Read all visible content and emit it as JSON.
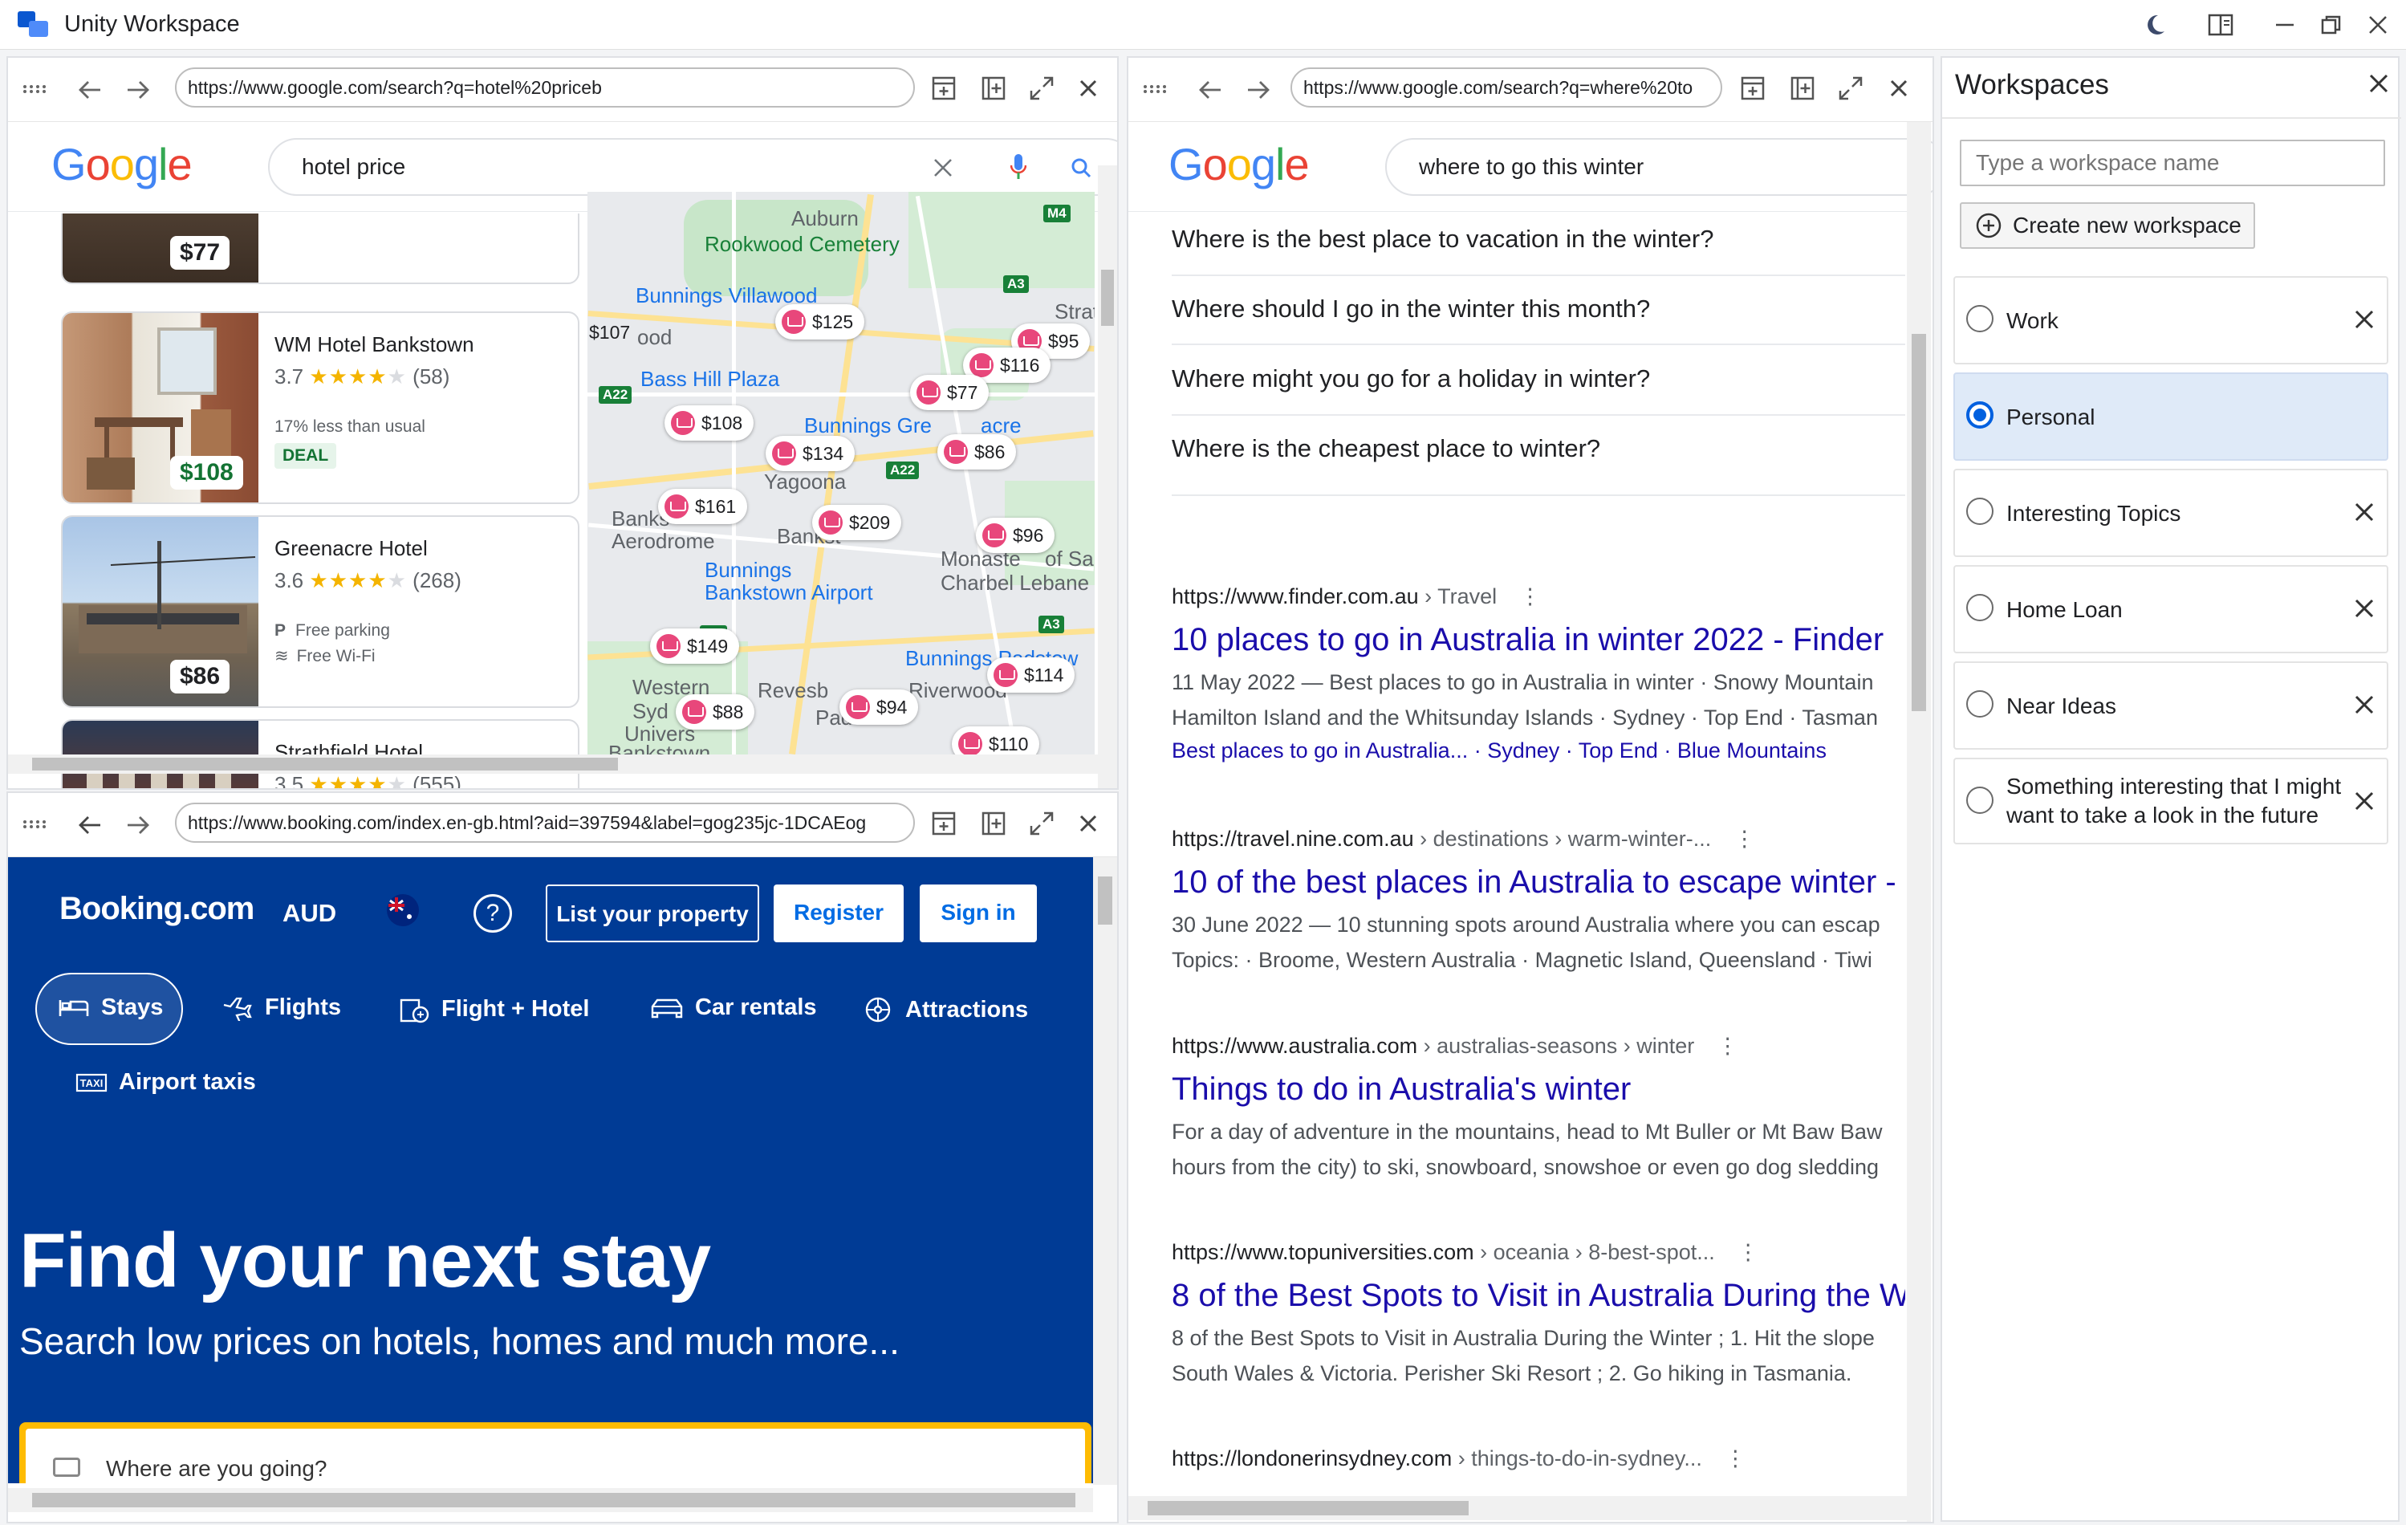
{
  "app": {
    "title": "Unity Workspace"
  },
  "pane_hotels": {
    "url": "https://www.google.com/search?q=hotel%20priceb",
    "search_query": "hotel price",
    "hotels": [
      {
        "name": "",
        "rating": "",
        "reviews": "",
        "price": "$77"
      },
      {
        "name": "WM Hotel Bankstown",
        "rating": "3.7",
        "reviews": "(58)",
        "note1": "17% less than usual",
        "badge": "DEAL",
        "price": "$108"
      },
      {
        "name": "Greenacre Hotel",
        "rating": "3.6",
        "reviews": "(268)",
        "note1": "Free parking",
        "note2": "Free Wi-Fi",
        "price": "$86"
      },
      {
        "name": "Strathfield Hotel",
        "rating": "3.5",
        "reviews": "(555)",
        "price": ""
      }
    ],
    "map": {
      "labels": [
        "Auburn",
        "Rookwood Cemetery",
        "Bunnings Villawood",
        "Strathfi",
        "ood",
        "Bass Hill Plaza",
        "Bunnings Gre",
        "acre",
        "Yagoona",
        "Banks",
        "Aerodrome",
        "Bankst",
        "Monaste",
        "of Sa",
        "Charbel Lebane",
        "Bunnings",
        "Bankstown Airport",
        "Bunnings Padstow",
        "Western",
        "Syd",
        "Univers",
        "Revesb",
        "Riverwood",
        "Pad",
        "Bankstown"
      ],
      "shields": [
        "M4",
        "A3",
        "A22",
        "A22",
        "A3",
        "M4"
      ],
      "pins": [
        "$125",
        "$95",
        "$107",
        "$116",
        "$77",
        "$108",
        "$134",
        "$86",
        "$161",
        "$209",
        "$96",
        "$149",
        "$114",
        "$88",
        "$94",
        "$110"
      ]
    }
  },
  "pane_booking": {
    "url": "https://www.booking.com/index.en-gb.html?aid=397594&label=gog235jc-1DCAEog",
    "logo": "Booking.com",
    "currency": "AUD",
    "help": "?",
    "list_property": "List your property",
    "register": "Register",
    "sign_in": "Sign in",
    "nav": [
      "Stays",
      "Flights",
      "Flight + Hotel",
      "Car rentals",
      "Attractions",
      "Airport taxis"
    ],
    "hero_title": "Find your next stay",
    "hero_sub": "Search low prices on hotels, homes and much more...",
    "search_placeholder": "Where are you going?"
  },
  "pane_winter": {
    "url": "https://www.google.com/search?q=where%20to",
    "search_query": "where to go this winter",
    "suggestions": [
      "Where is the best place to vacation in the winter?",
      "Where should I go in the winter this month?",
      "Where might you go for a holiday in winter?",
      "Where is the cheapest place to winter?"
    ],
    "results": [
      {
        "site": "https://www.finder.com.au",
        "path": " › Travel",
        "title": "10 places to go in Australia in winter 2022 - Finder",
        "snip1": "11 May 2022 — Best places to go in Australia in winter · Snowy Mountain",
        "snip2": "Hamilton Island and the Whitsunday Islands · Sydney · Top End · Tasman",
        "links": "Best places to go in Australia... · Sydney · Top End · Blue Mountains"
      },
      {
        "site": "https://travel.nine.com.au",
        "path": " › destinations › warm-winter-...",
        "title": "10 of the best places in Australia to escape winter -",
        "snip1": "30 June 2022 — 10 stunning spots around Australia where you can escap",
        "snip2": "Topics: · Broome, Western Australia · Magnetic Island, Queensland · Tiwi"
      },
      {
        "site": "https://www.australia.com",
        "path": " › australias-seasons › winter",
        "title": "Things to do in Australia's winter",
        "snip1": "For a day of adventure in the mountains, head to Mt Buller or Mt Baw Baw",
        "snip2": "hours from the city) to ski, snowboard, snowshoe or even go dog sledding"
      },
      {
        "site": "https://www.topuniversities.com",
        "path": " › oceania › 8-best-spot...",
        "title": "8 of the Best Spots to Visit in Australia During the W",
        "snip1": "8 of the Best Spots to Visit in Australia During the Winter ; 1. Hit the slope",
        "snip2": "South Wales & Victoria. Perisher Ski Resort ; 2. Go hiking in Tasmania."
      },
      {
        "site": "https://londonerinsydney.com",
        "path": " › things-to-do-in-sydney..."
      }
    ]
  },
  "workspaces": {
    "title": "Workspaces",
    "input_placeholder": "Type a workspace name",
    "create_label": "Create new workspace",
    "items": [
      {
        "label": "Work",
        "selected": false
      },
      {
        "label": "Personal",
        "selected": true
      },
      {
        "label": "Interesting Topics",
        "selected": false
      },
      {
        "label": "Home Loan",
        "selected": false
      },
      {
        "label": "Near Ideas",
        "selected": false
      },
      {
        "label": "Something interesting that I might want to take a look in the future",
        "selected": false
      }
    ]
  },
  "colors": {
    "google_blue": "#4285F4",
    "google_red": "#EA4335",
    "google_yellow": "#FBBC05",
    "google_green": "#34A853",
    "booking_blue": "#003b95",
    "booking_yellow": "#febb02",
    "link": "#1a0dab",
    "accent": "#0060df"
  }
}
